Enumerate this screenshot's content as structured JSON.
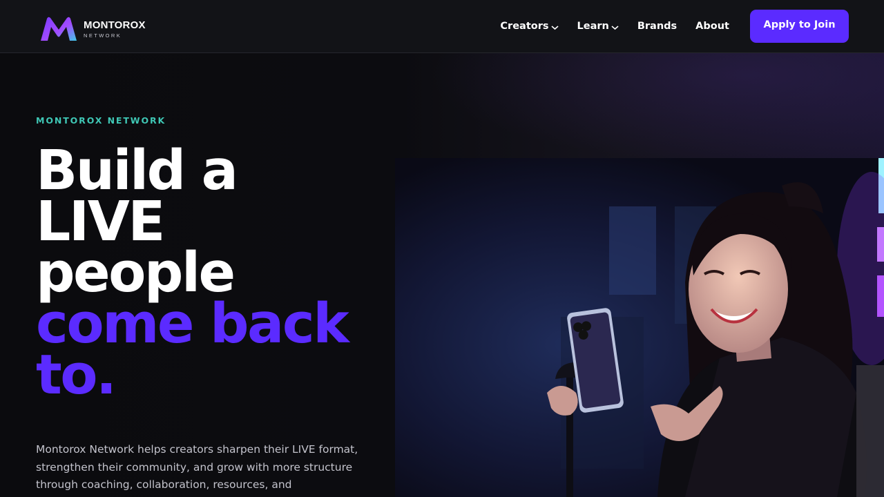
{
  "brand": {
    "name": "MONTOROX",
    "sub": "NETWORK",
    "colors": {
      "primary": "#5b2bff",
      "eyebrow": "#3fc7b5",
      "nav_bg": "#121317",
      "page_bg": "#0b0b0e"
    }
  },
  "nav": {
    "items": [
      {
        "label": "Creators",
        "icon": "chevron-down-icon"
      },
      {
        "label": "Learn",
        "icon": "chevron-down-icon"
      },
      {
        "label": "Brands"
      },
      {
        "label": "About"
      }
    ],
    "cta": "Apply to Join"
  },
  "hero": {
    "eyebrow": "MONTOROX NETWORK",
    "headline_white": [
      "Build a",
      "LIVE",
      "people"
    ],
    "headline_accent": [
      "come back",
      "to."
    ],
    "description": "Montorox Network helps creators sharpen their LIVE format, strengthen their community, and grow with more structure through coaching, collaboration, resources, and",
    "image": "creator-livestreaming-photo"
  }
}
